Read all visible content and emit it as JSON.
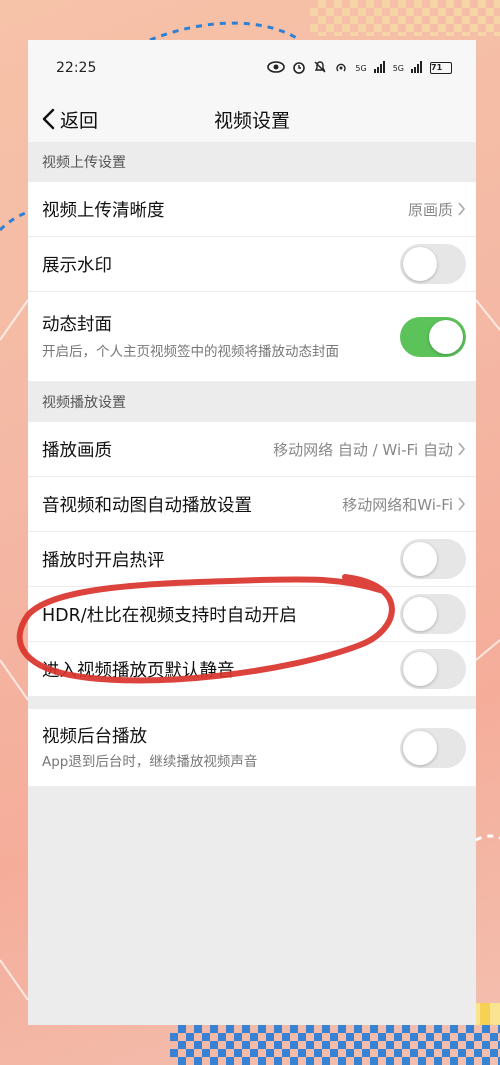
{
  "status_bar": {
    "time": "22:25",
    "battery": "71",
    "signal_1": "5G",
    "signal_2": "5G"
  },
  "nav": {
    "back_label": "返回",
    "title": "视频设置"
  },
  "sections": {
    "upload_header": "视频上传设置",
    "playback_header": "视频播放设置"
  },
  "upload": {
    "quality_title": "视频上传清晰度",
    "quality_value": "原画质",
    "watermark_title": "展示水印",
    "watermark_on": false,
    "dynamic_cover_title": "动态封面",
    "dynamic_cover_desc": "开启后，个人主页视频签中的视频将播放动态封面",
    "dynamic_cover_on": true
  },
  "playback": {
    "quality_title": "播放画质",
    "quality_value": "移动网络 自动 / Wi-Fi 自动",
    "autoplay_title": "音视频和动图自动播放设置",
    "autoplay_value": "移动网络和Wi-Fi",
    "hot_comment_title": "播放时开启热评",
    "hot_comment_on": false,
    "hdr_title": "HDR/杜比在视频支持时自动开启",
    "hdr_on": false,
    "mute_title": "进入视频播放页默认静音",
    "mute_on": false
  },
  "background": {
    "title": "视频后台播放",
    "desc": "App退到后台时，继续播放视频声音",
    "on": false
  },
  "colors": {
    "toggle_on": "#5cc25a",
    "toggle_off": "#e6e6e6",
    "annotation_red": "#d9332b",
    "accent_blue": "#2e7fd6"
  }
}
